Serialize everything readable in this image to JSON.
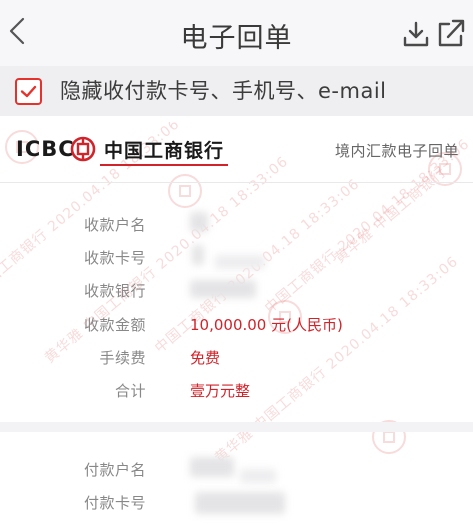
{
  "nav": {
    "title": "电子回单",
    "back_icon": "chevron-left-icon",
    "download_icon": "download-icon",
    "share_icon": "external-share-icon"
  },
  "hide_option": {
    "checked": true,
    "label": "隐藏收付款卡号、手机号、e-mail"
  },
  "bank": {
    "logo_text": "ICBC",
    "logo_mark": "icbc-logo-mark",
    "name": "中国工商银行",
    "doc_type": "境内汇款电子回单"
  },
  "payee": {
    "name_label": "收款户名",
    "card_label": "收款卡号",
    "bank_label": "收款银行",
    "amount_label": "收款金额",
    "amount_value": "10,000.00 元(人民币)",
    "fee_label": "手续费",
    "fee_value": "免费",
    "total_label": "合计",
    "total_value": "壹万元整"
  },
  "payer": {
    "name_label": "付款户名",
    "card_label": "付款卡号"
  },
  "watermark": {
    "lines": [
      "中国工商银行 2020.04.18 18:33:06",
      "黄华雅 中国工商银行 2020.04.18 18:33:06",
      "中国工商银行 2020.04.18 18:33:06",
      "黄华雅 中国工商银行 2020.04.18 18:33:06",
      "中国工商银行 2020.04.18 18:33:06",
      "黄华雅 中国工商银行"
    ]
  },
  "colors": {
    "accent_red": "#d1232a",
    "checkbox_red": "#e5322d"
  }
}
